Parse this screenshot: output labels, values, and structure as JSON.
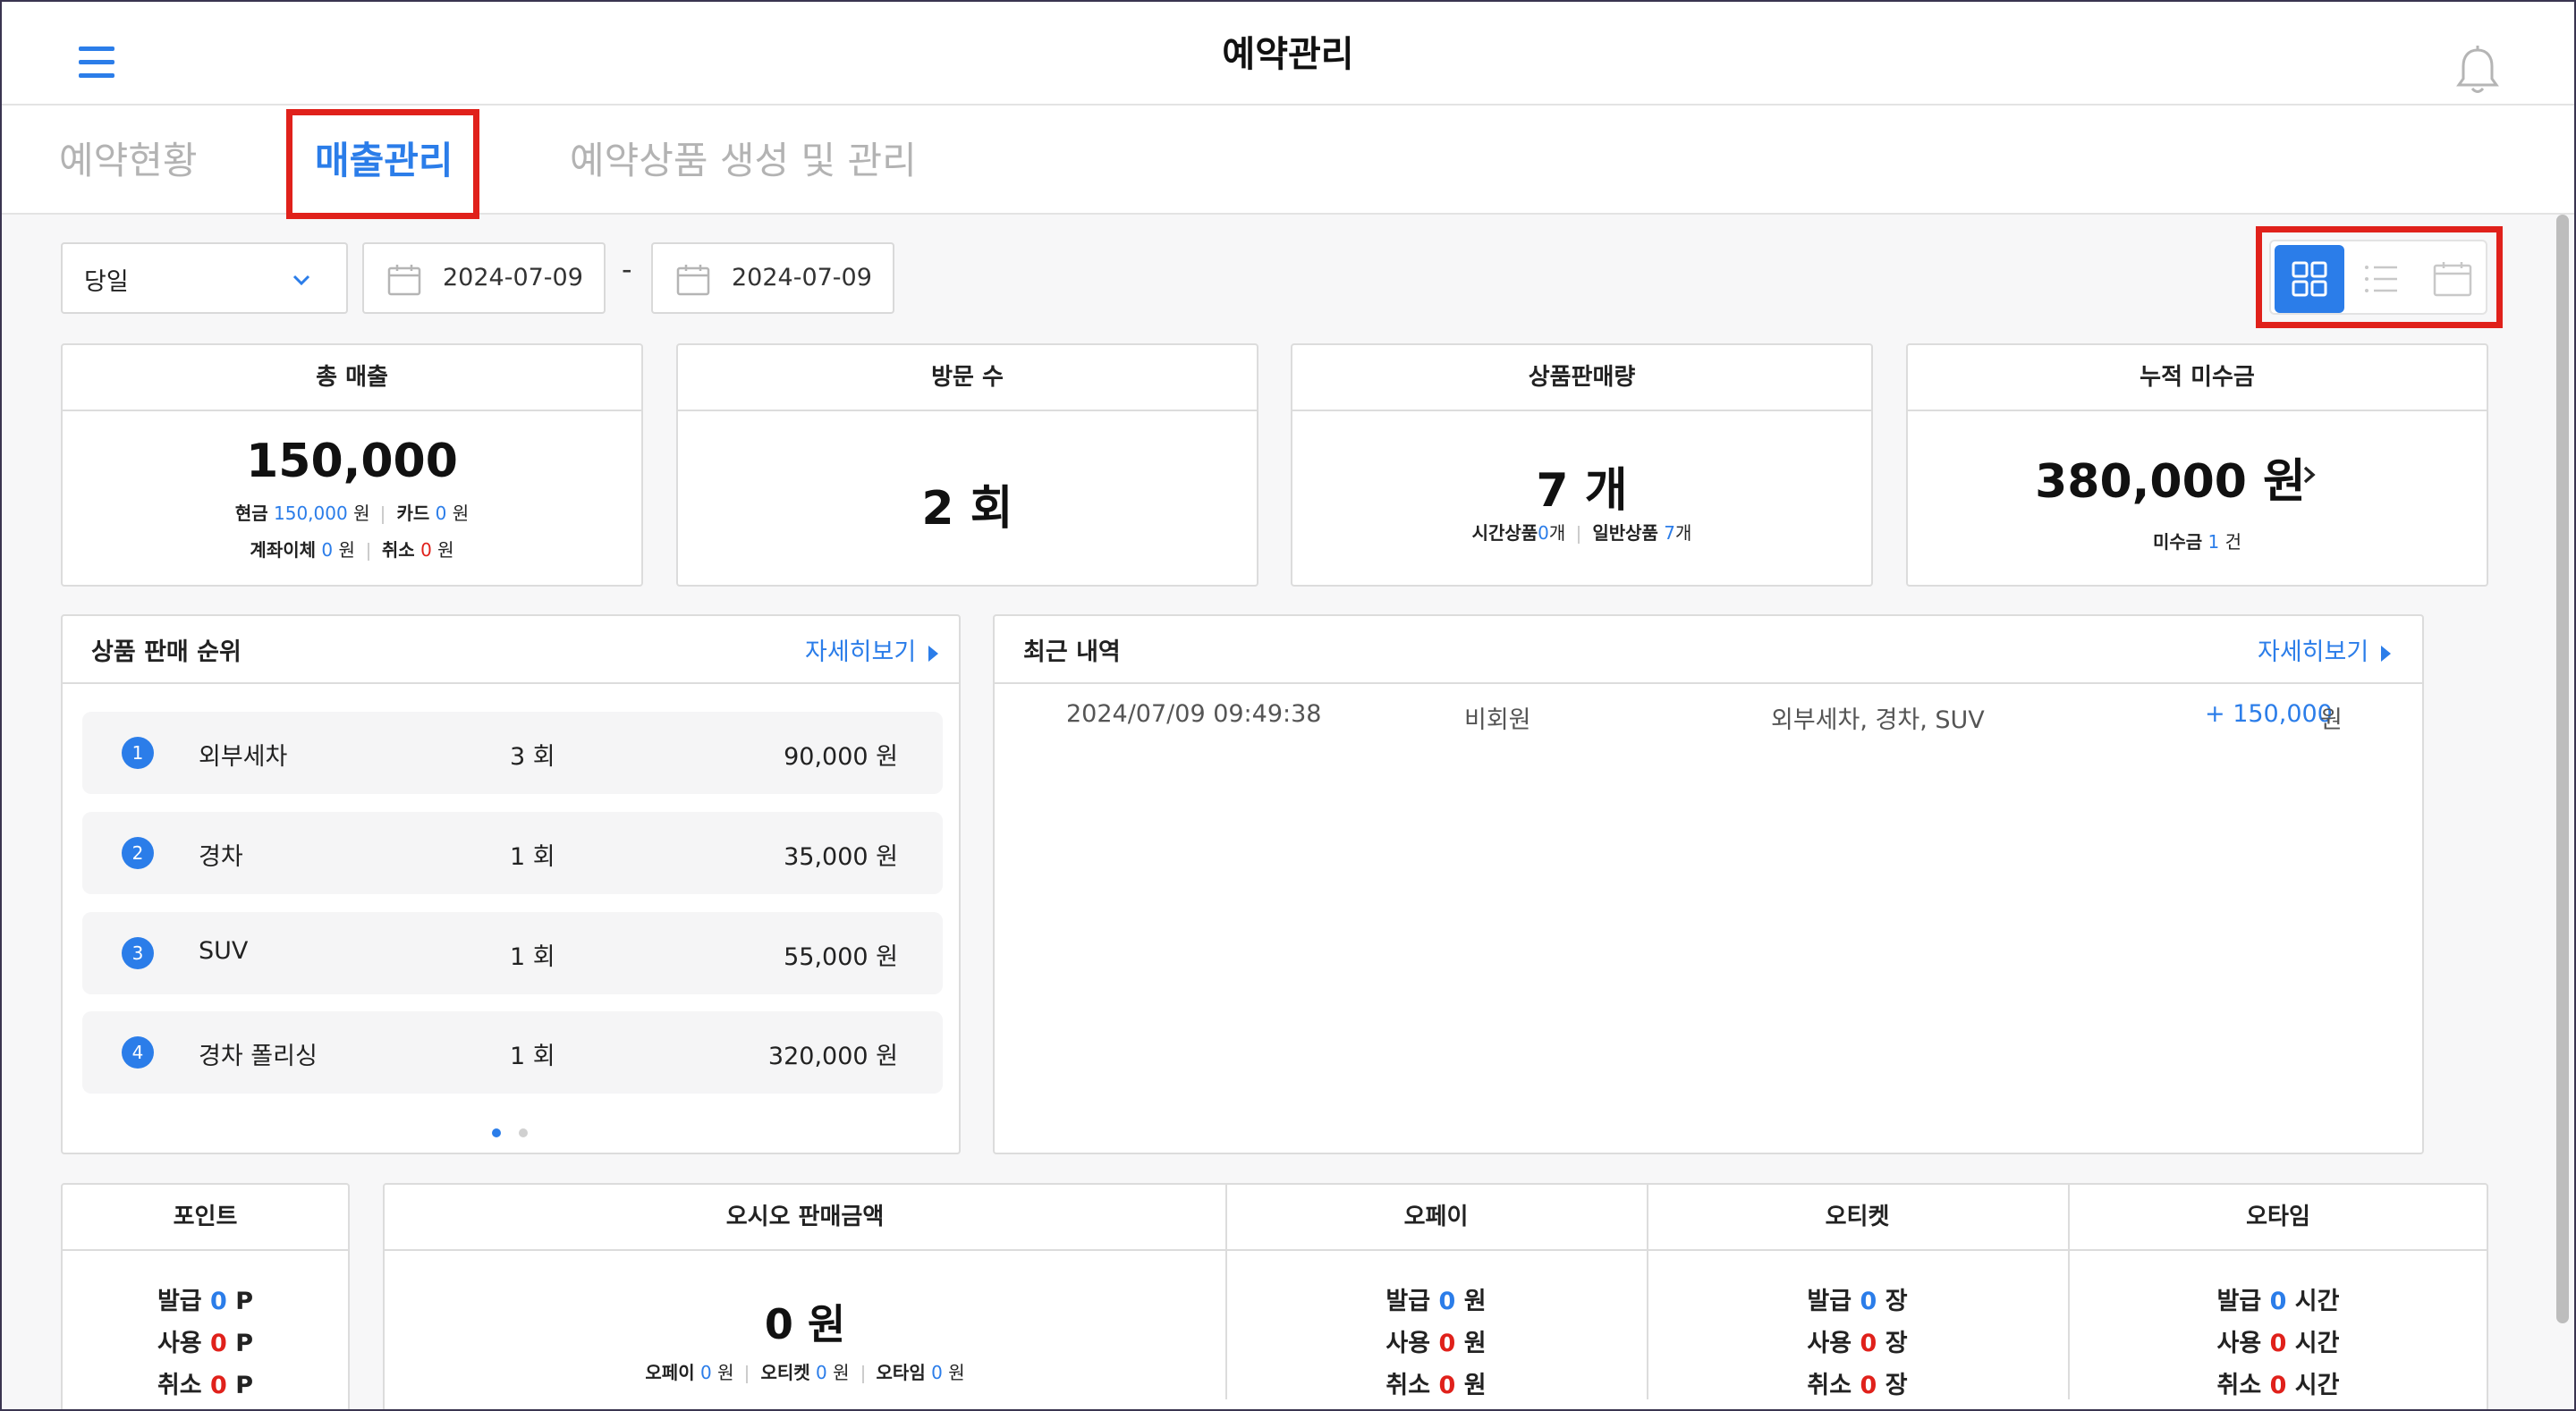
{
  "header": {
    "title": "예약관리"
  },
  "tabs": [
    {
      "label": "예약현황"
    },
    {
      "label": "매출관리"
    },
    {
      "label": "예약상품 생성 및 관리"
    }
  ],
  "filters": {
    "period": "당일",
    "start_date": "2024-07-09",
    "separator": "-",
    "end_date": "2024-07-09"
  },
  "view_modes": {
    "selected": "grid",
    "options": [
      "grid-icon",
      "list-icon",
      "calendar-icon"
    ]
  },
  "stats": {
    "total_sales": {
      "title": "총 매출",
      "value": "150,000",
      "cash_label": "현금",
      "cash_value": "150,000",
      "cash_unit": "원",
      "card_label": "카드",
      "card_value": "0",
      "card_unit": "원",
      "transfer_label": "계좌이체",
      "transfer_value": "0",
      "transfer_unit": "원",
      "cancel_label": "취소",
      "cancel_value": "0",
      "cancel_unit": "원"
    },
    "visits": {
      "title": "방문 수",
      "value": "2 회"
    },
    "products_sold": {
      "title": "상품판매량",
      "value": "7 개",
      "time_label": "시간상품",
      "time_value": "0",
      "time_unit": "개",
      "general_label": "일반상품",
      "general_value": "7",
      "general_unit": "개"
    },
    "receivables": {
      "title": "누적 미수금",
      "value": "380,000 원",
      "count_label": "미수금",
      "count_value": "1",
      "count_unit": "건"
    }
  },
  "ranking": {
    "title": "상품 판매 순위",
    "more": "자세히보기",
    "rows": [
      {
        "rank": "1",
        "name": "외부세차",
        "count": "3 회",
        "amount": "90,000 원"
      },
      {
        "rank": "2",
        "name": "경차",
        "count": "1 회",
        "amount": "35,000 원"
      },
      {
        "rank": "3",
        "name": "SUV",
        "count": "1 회",
        "amount": "55,000 원"
      },
      {
        "rank": "4",
        "name": "경차 폴리싱",
        "count": "1 회",
        "amount": "320,000 원"
      }
    ]
  },
  "recent": {
    "title": "최근 내역",
    "more": "자세히보기",
    "rows": [
      {
        "datetime": "2024/07/09 09:49:38",
        "member": "비회원",
        "items": "외부세차, 경차, SUV",
        "amount": "+ 150,000",
        "unit": "원"
      }
    ]
  },
  "point": {
    "title": "포인트",
    "issue_label": "발급",
    "issue_value": "0",
    "issue_unit": "P",
    "use_label": "사용",
    "use_value": "0",
    "use_unit": "P",
    "cancel_label": "취소",
    "cancel_value": "0",
    "cancel_unit": "P"
  },
  "osio": {
    "title": "오시오 판매금액",
    "value": "0 원",
    "opay_label": "오페이",
    "opay_value": "0",
    "opay_unit": "원",
    "oticket_label": "오티켓",
    "oticket_value": "0",
    "oticket_unit": "원",
    "otime_label": "오타임",
    "otime_value": "0",
    "otime_unit": "원"
  },
  "opay": {
    "title": "오페이",
    "issue_label": "발급",
    "issue_value": "0",
    "unit": "원",
    "use_label": "사용",
    "use_value": "0",
    "cancel_label": "취소",
    "cancel_value": "0"
  },
  "oticket": {
    "title": "오티켓",
    "issue_label": "발급",
    "issue_value": "0",
    "unit": "장",
    "use_label": "사용",
    "use_value": "0",
    "cancel_label": "취소",
    "cancel_value": "0"
  },
  "otime": {
    "title": "오타임",
    "issue_label": "발급",
    "issue_value": "0",
    "unit": "시간",
    "use_label": "사용",
    "use_value": "0",
    "cancel_label": "취소",
    "cancel_value": "0"
  },
  "colors": {
    "accent": "#2b7de9",
    "danger": "#e0211b",
    "highlight": "#e0211b"
  }
}
